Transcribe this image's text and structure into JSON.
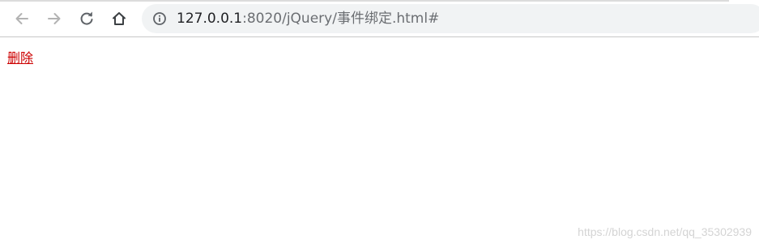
{
  "browser": {
    "nav": {
      "back_icon": "arrow-left-icon",
      "forward_icon": "arrow-right-icon",
      "reload_icon": "reload-icon",
      "home_icon": "home-icon"
    },
    "address": {
      "icon": "info-icon",
      "host": "127.0.0.1",
      "path": ":8020/jQuery/事件绑定.html#"
    }
  },
  "page": {
    "delete_link": "删除",
    "watermark": "https://blog.csdn.net/qq_35302939"
  },
  "colors": {
    "link": "#cc0000",
    "omnibox_bg": "#f1f3f4",
    "icon_disabled": "#b3b3b3",
    "icon_enabled": "#5f6368"
  }
}
